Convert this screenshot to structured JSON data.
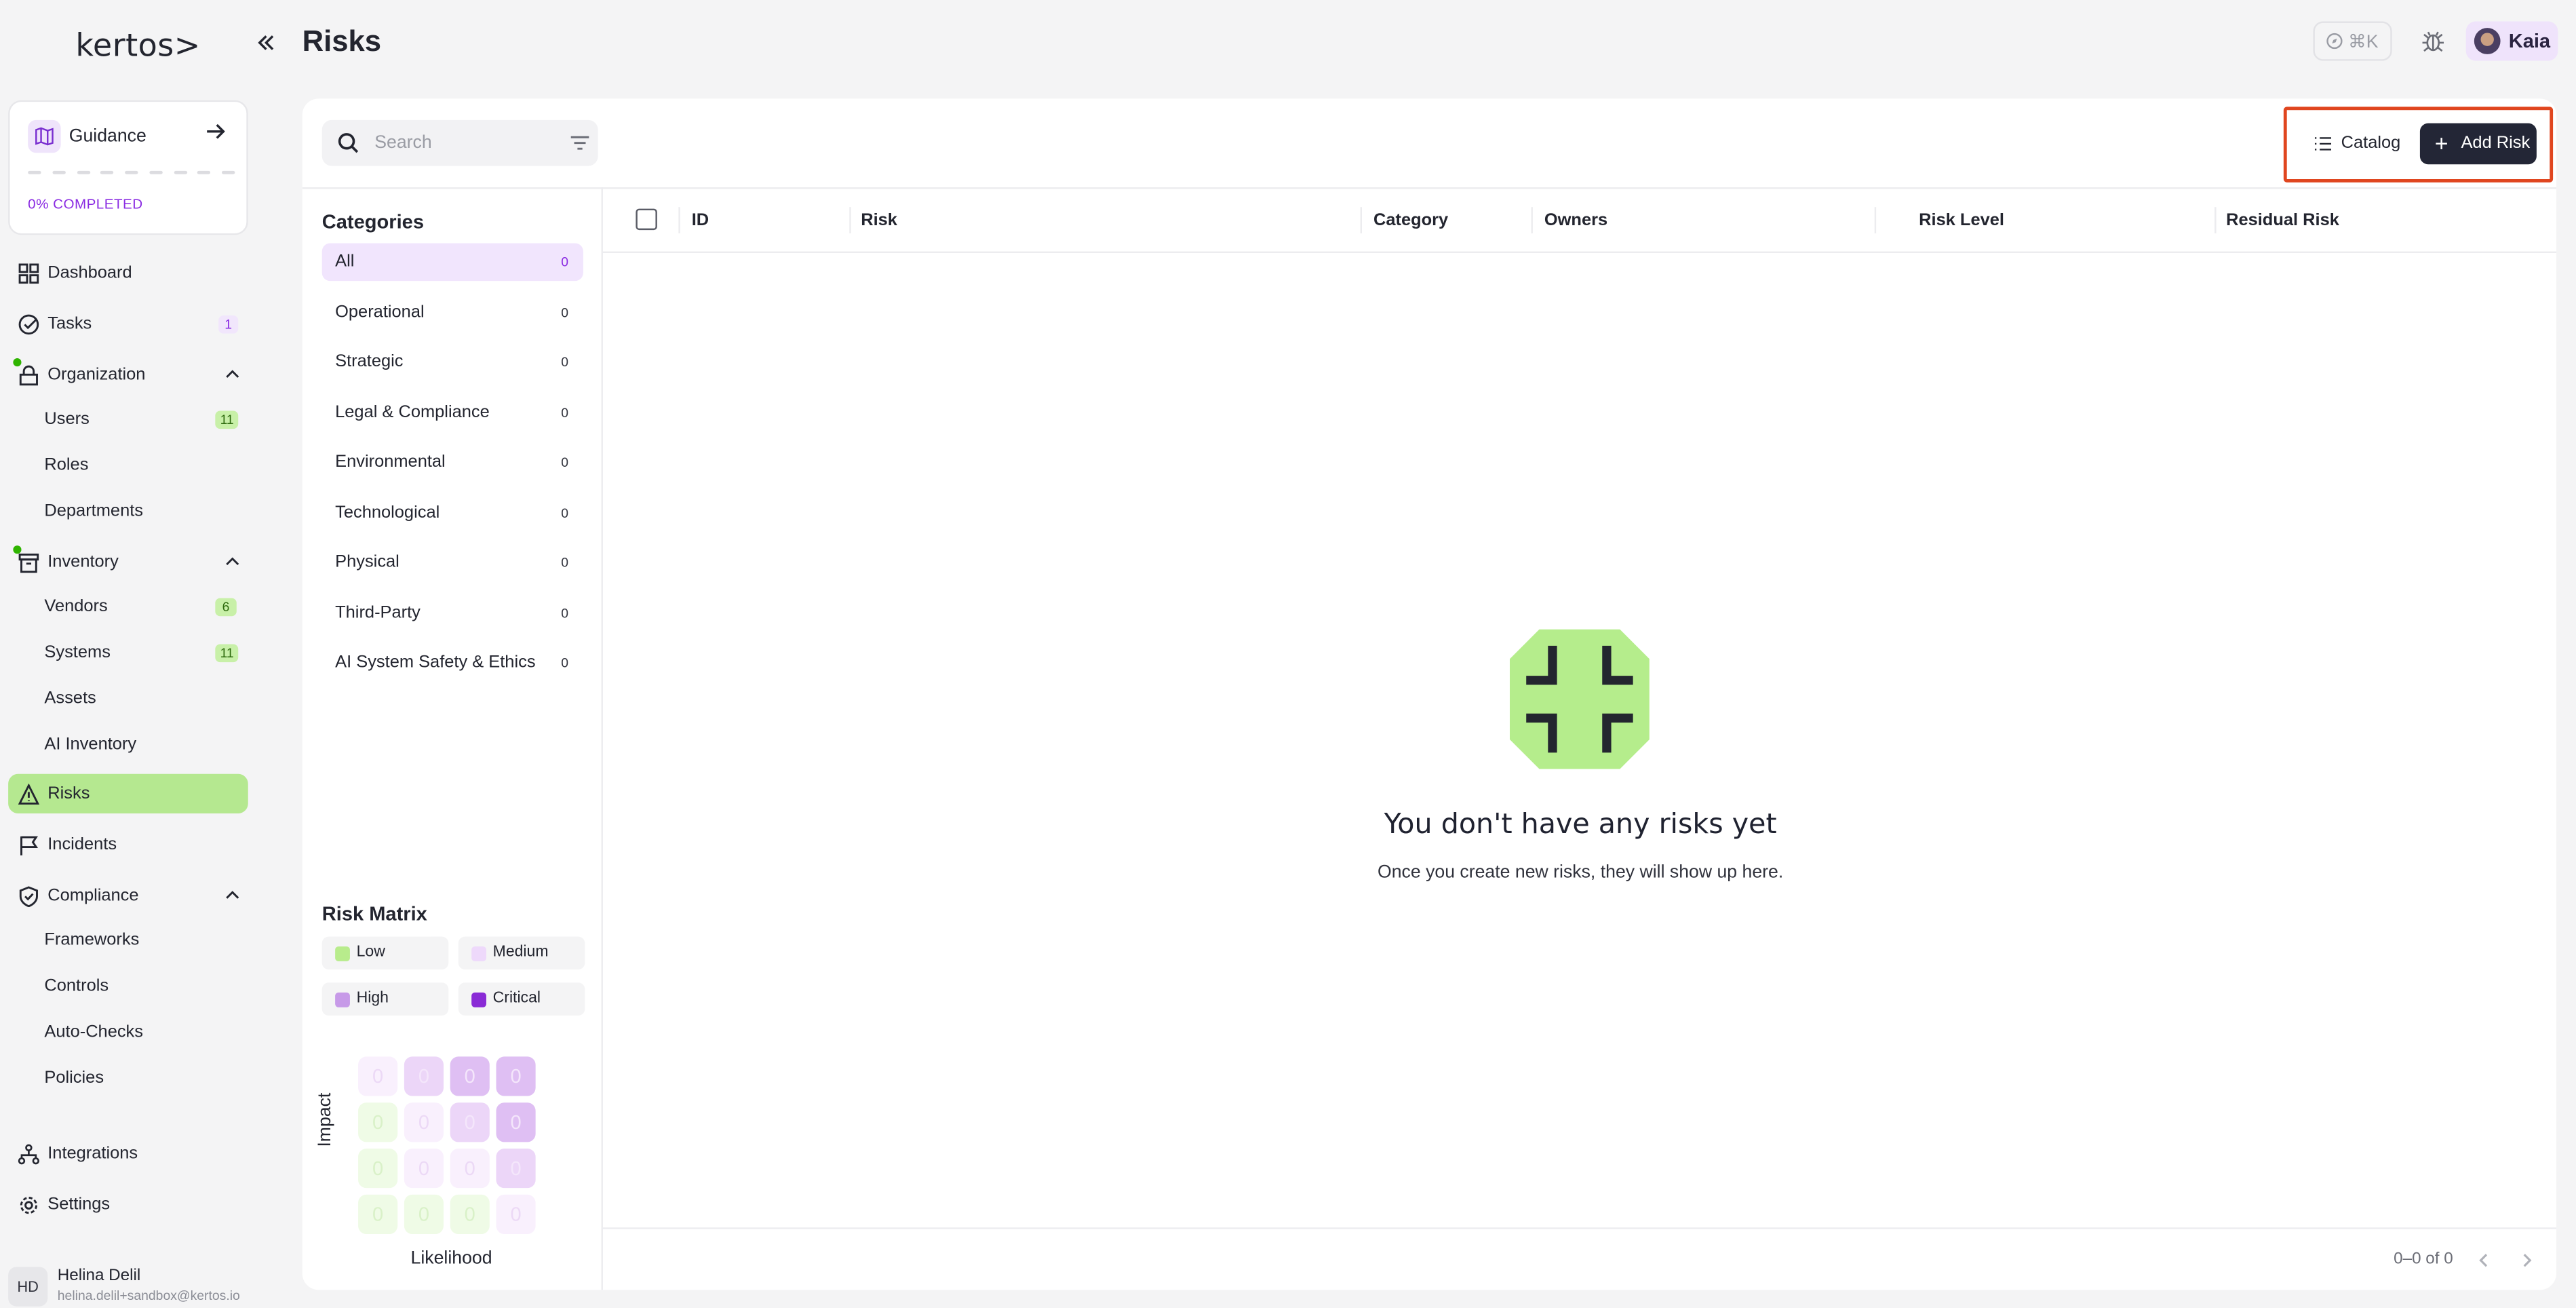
{
  "app": {
    "logo_text": "kertos>",
    "collapse_icon": "double-chevron-left-icon"
  },
  "guidance": {
    "label": "Guidance",
    "progress_label": "0% COMPLETED",
    "progress_percent": 0,
    "steps_total": 9
  },
  "sidebar": {
    "dashboard": "Dashboard",
    "tasks": "Tasks",
    "tasks_badge": "1",
    "organization": "Organization",
    "users": "Users",
    "users_badge": "11",
    "roles": "Roles",
    "departments": "Departments",
    "inventory": "Inventory",
    "vendors": "Vendors",
    "vendors_badge": "6",
    "systems": "Systems",
    "systems_badge": "11",
    "assets": "Assets",
    "ai_inventory": "AI Inventory",
    "risks": "Risks",
    "incidents": "Incidents",
    "compliance": "Compliance",
    "frameworks": "Frameworks",
    "controls": "Controls",
    "auto_checks": "Auto-Checks",
    "policies": "Policies",
    "integrations": "Integrations",
    "settings": "Settings"
  },
  "user": {
    "initials": "HD",
    "name": "Helina Delil",
    "email": "helina.delil+sandbox@kertos.io"
  },
  "header": {
    "title": "Risks",
    "cmdk_label": "⌘K",
    "user_name": "Kaia"
  },
  "search": {
    "placeholder": "Search",
    "value": ""
  },
  "toolbar": {
    "catalog_label": "Catalog",
    "add_label": "Add Risk"
  },
  "categories": {
    "title": "Categories",
    "items": [
      {
        "label": "All",
        "count": "0"
      },
      {
        "label": "Operational",
        "count": "0"
      },
      {
        "label": "Strategic",
        "count": "0"
      },
      {
        "label": "Legal & Compliance",
        "count": "0"
      },
      {
        "label": "Environmental",
        "count": "0"
      },
      {
        "label": "Technological",
        "count": "0"
      },
      {
        "label": "Physical",
        "count": "0"
      },
      {
        "label": "Third-Party",
        "count": "0"
      },
      {
        "label": "AI System Safety & Ethics",
        "count": "0"
      }
    ]
  },
  "risk_matrix": {
    "title": "Risk Matrix",
    "legend": [
      {
        "label": "Low",
        "color": "#b8ec8c"
      },
      {
        "label": "Medium",
        "color": "#eed9fb"
      },
      {
        "label": "High",
        "color": "#c79ae8"
      },
      {
        "label": "Critical",
        "color": "#8a2bd6"
      }
    ],
    "rows": [
      [
        "0",
        "0",
        "0",
        "0"
      ],
      [
        "0",
        "0",
        "0",
        "0"
      ],
      [
        "0",
        "0",
        "0",
        "0"
      ],
      [
        "0",
        "0",
        "0",
        "0"
      ]
    ],
    "y_label": "Impact",
    "x_label": "Likelihood"
  },
  "table": {
    "columns": [
      "ID",
      "Risk",
      "Category",
      "Owners",
      "Risk Level",
      "Residual Risk"
    ]
  },
  "empty_state": {
    "title": "You don't have any risks yet",
    "subtitle": "Once you create new risks, they will show up here."
  },
  "pagination": {
    "range": "0–0 of 0"
  }
}
